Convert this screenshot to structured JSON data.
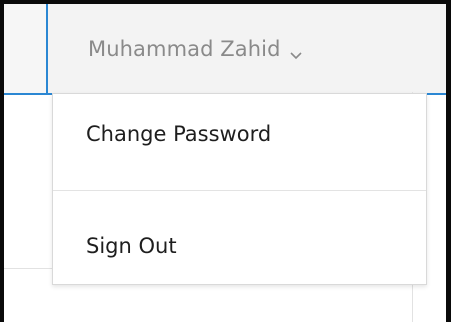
{
  "header": {
    "user_name": "Muhammad Zahid",
    "chevron_icon": "chevron-down-icon",
    "accent_color": "#2b87d3"
  },
  "user_menu": {
    "items": [
      {
        "label": "Change Password"
      },
      {
        "label": "Sign Out"
      }
    ]
  }
}
